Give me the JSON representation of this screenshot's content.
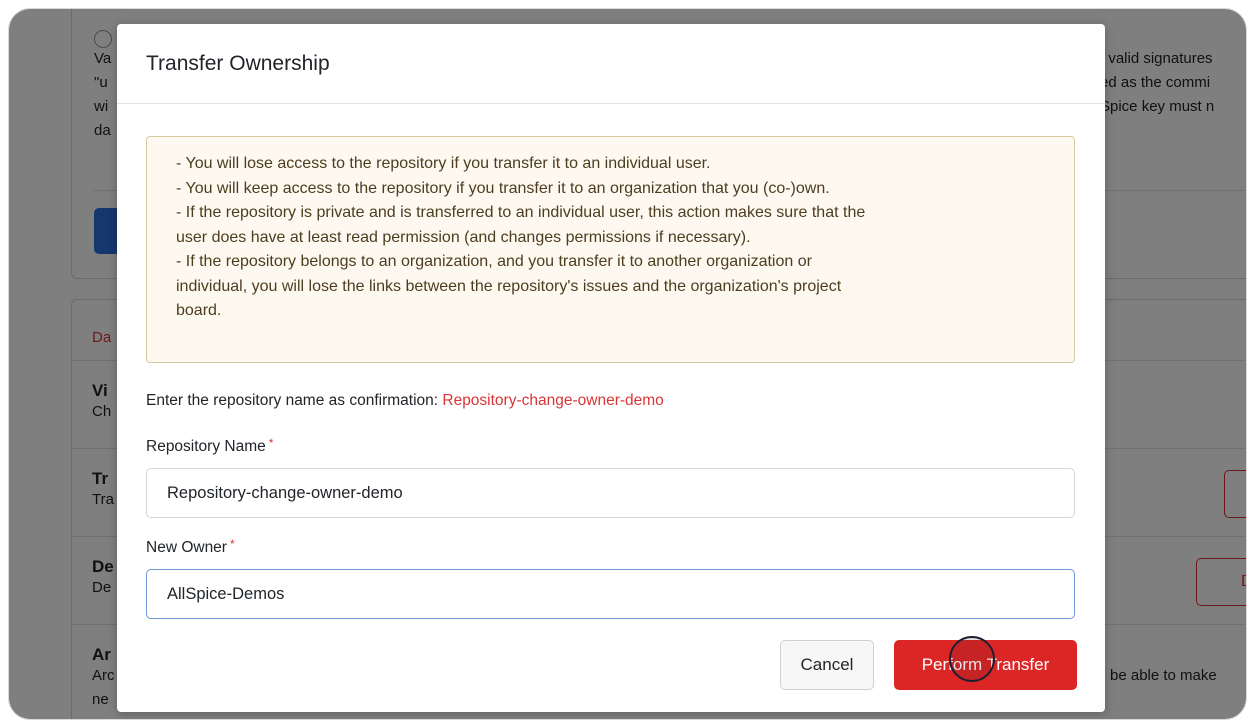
{
  "background": {
    "top_right_lines": [
      ", valid signatures",
      "ed as the commi",
      "Spice key must n"
    ],
    "left_fragments": [
      "Va",
      "\"u",
      "wi",
      "da"
    ],
    "danger_header": "Da",
    "rows": [
      {
        "title": "Vi",
        "desc": "Ch"
      },
      {
        "title": "Tr",
        "desc": "Tra"
      },
      {
        "title": "De",
        "desc": "De"
      },
      {
        "title": "Ar",
        "desc": "Arc"
      }
    ],
    "bottom_fragment": "ne",
    "right_bottom_text": "be able to make",
    "delete_button_fragment": "Del"
  },
  "modal": {
    "title": "Transfer Ownership",
    "warnings": [
      "- You will lose access to the repository if you transfer it to an individual user.",
      "- You will keep access to the repository if you transfer it to an organization that you (co-)own.",
      "- If the repository is private and is transferred to an individual user, this action makes sure that the",
      "user does have at least read permission (and changes permissions if necessary).",
      "- If the repository belongs to an organization, and you transfer it to another organization or",
      "individual, you will lose the links between the repository's issues and the organization's project",
      "board."
    ],
    "confirm_prompt": "Enter the repository name as confirmation:",
    "confirm_repo_name": "Repository-change-owner-demo",
    "repo_name_label": "Repository Name",
    "repo_name_value": "Repository-change-owner-demo",
    "new_owner_label": "New Owner",
    "new_owner_value": "AllSpice-Demos",
    "required_mark": "*",
    "cancel_label": "Cancel",
    "submit_label": "Perform Transfer",
    "colors": {
      "danger": "#dc2626",
      "focus_border": "#6d98d8",
      "warning_bg": "#fdf8f0"
    }
  }
}
